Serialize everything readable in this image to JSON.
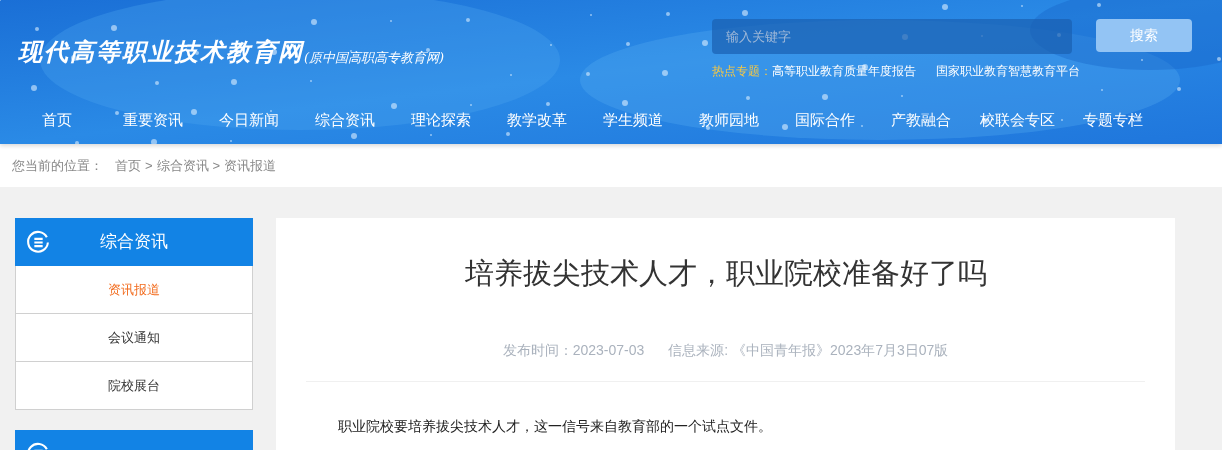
{
  "header": {
    "logo": "现代高等职业技术教育网",
    "logo_subtitle": "(原中国高职高专教育网)",
    "search": {
      "placeholder": "输入关键字",
      "button": "搜索"
    },
    "hot_topics": {
      "label": "热点专题：",
      "links": [
        "高等职业教育质量年度报告",
        "国家职业教育智慧教育平台"
      ]
    }
  },
  "nav": [
    "首页",
    "重要资讯",
    "今日新闻",
    "综合资讯",
    "理论探索",
    "教学改革",
    "学生频道",
    "教师园地",
    "国际合作",
    "产教融合",
    "校联会专区",
    "专题专栏"
  ],
  "breadcrumb": {
    "label": "您当前的位置：",
    "items": [
      "首页",
      "综合资讯",
      "资讯报道"
    ],
    "separator": ">"
  },
  "sidebar": {
    "title": "综合资讯",
    "items": [
      {
        "label": "资讯报道",
        "selected": true
      },
      {
        "label": "会议通知",
        "selected": false
      },
      {
        "label": "院校展台",
        "selected": false
      }
    ]
  },
  "article": {
    "title": "培养拔尖技术人才，职业院校准备好了吗",
    "published_label": "发布时间：",
    "published": "2023-07-03",
    "source_label": "信息来源:",
    "source": "《中国青年报》2023年7月3日07版",
    "paragraphs": [
      "职业院校要培养拔尖技术人才，这一信号来自教育部的一个试点文件。"
    ]
  }
}
